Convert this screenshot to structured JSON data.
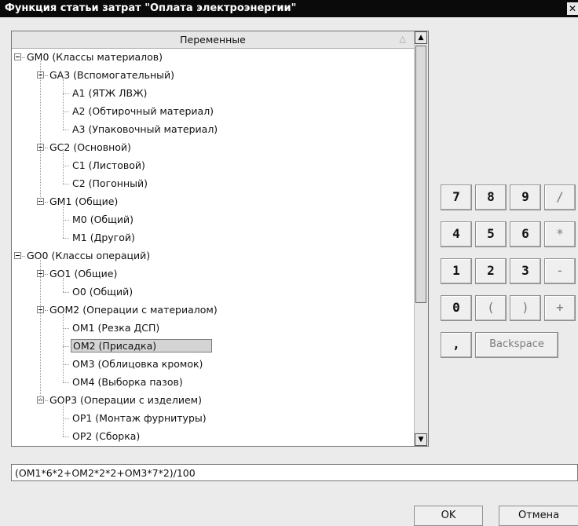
{
  "window": {
    "title": "Функция статьи затрат \"Оплата электроэнергии\"",
    "close_glyph": "✕"
  },
  "tree": {
    "header": "Переменные",
    "items": [
      {
        "label": "GM0 (Классы материалов)",
        "level": 0,
        "expandable": true
      },
      {
        "label": "GA3 (Вспомогательный)",
        "level": 1,
        "expandable": true
      },
      {
        "label": "A1 (ЯТЖ ЛВЖ)",
        "level": 2,
        "expandable": false
      },
      {
        "label": "A2 (Обтирочный материал)",
        "level": 2,
        "expandable": false
      },
      {
        "label": "A3 (Упаковочный материал)",
        "level": 2,
        "expandable": false
      },
      {
        "label": "GC2 (Основной)",
        "level": 1,
        "expandable": true
      },
      {
        "label": "C1 (Листовой)",
        "level": 2,
        "expandable": false
      },
      {
        "label": "C2 (Погонный)",
        "level": 2,
        "expandable": false
      },
      {
        "label": "GM1 (Общие)",
        "level": 1,
        "expandable": true
      },
      {
        "label": "M0 (Общий)",
        "level": 2,
        "expandable": false
      },
      {
        "label": "M1 (Другой)",
        "level": 2,
        "expandable": false
      },
      {
        "label": "GO0 (Классы операций)",
        "level": 0,
        "expandable": true
      },
      {
        "label": "GO1 (Общие)",
        "level": 1,
        "expandable": true
      },
      {
        "label": "O0 (Общий)",
        "level": 2,
        "expandable": false
      },
      {
        "label": "GOM2 (Операции с материалом)",
        "level": 1,
        "expandable": true
      },
      {
        "label": "OM1 (Резка ДСП)",
        "level": 2,
        "expandable": false
      },
      {
        "label": "OM2 (Присадка)",
        "level": 2,
        "expandable": false,
        "selected": true
      },
      {
        "label": "OM3 (Облицовка кромок)",
        "level": 2,
        "expandable": false
      },
      {
        "label": "OM4 (Выборка пазов)",
        "level": 2,
        "expandable": false
      },
      {
        "label": "GOP3 (Операции с изделием)",
        "level": 1,
        "expandable": true
      },
      {
        "label": "OP1 (Монтаж фурнитуры)",
        "level": 2,
        "expandable": false
      },
      {
        "label": "OP2 (Сборка)",
        "level": 2,
        "expandable": false
      }
    ]
  },
  "keypad": {
    "rows": [
      [
        {
          "label": "7",
          "type": "digit"
        },
        {
          "label": "8",
          "type": "digit"
        },
        {
          "label": "9",
          "type": "digit"
        },
        {
          "label": "/",
          "type": "op"
        }
      ],
      [
        {
          "label": "4",
          "type": "digit"
        },
        {
          "label": "5",
          "type": "digit"
        },
        {
          "label": "6",
          "type": "digit"
        },
        {
          "label": "*",
          "type": "op"
        }
      ],
      [
        {
          "label": "1",
          "type": "digit"
        },
        {
          "label": "2",
          "type": "digit"
        },
        {
          "label": "3",
          "type": "digit"
        },
        {
          "label": "-",
          "type": "op"
        }
      ],
      [
        {
          "label": "0",
          "type": "digit"
        },
        {
          "label": "(",
          "type": "op"
        },
        {
          "label": ")",
          "type": "op"
        },
        {
          "label": "+",
          "type": "op"
        }
      ]
    ],
    "comma": ",",
    "backspace": "Backspace"
  },
  "formula": {
    "value": "(OM1*6*2+OM2*2*2+OM3*7*2)/100"
  },
  "buttons": {
    "ok": "OK",
    "cancel": "Отмена"
  },
  "colors": {
    "title_bar": "#0a0a0a",
    "selection": "#d4d4d4",
    "window_bg": "#ebebeb"
  }
}
